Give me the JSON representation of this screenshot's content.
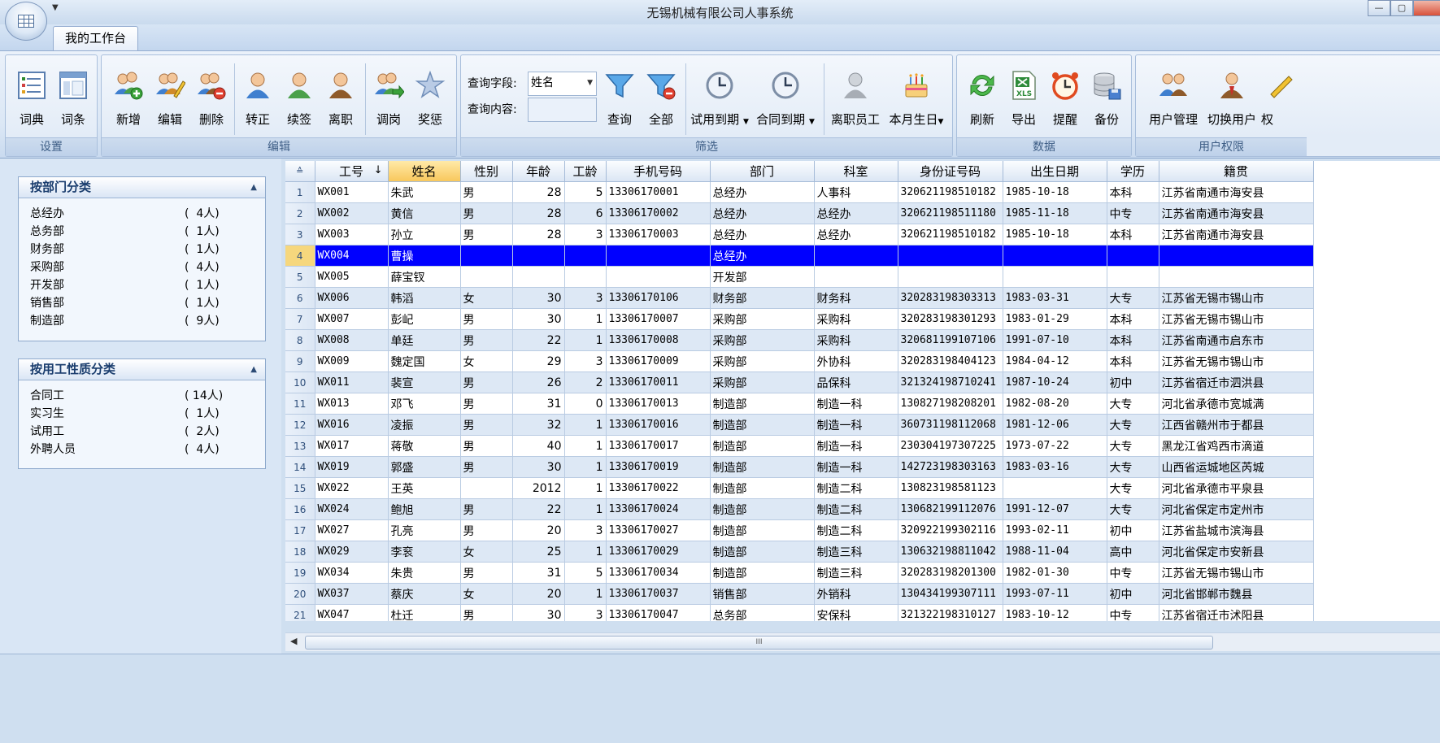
{
  "window": {
    "title": "无锡机械有限公司人事系统"
  },
  "ribbon": {
    "tab": "我的工作台",
    "groups": {
      "settings": {
        "label": "设置",
        "buttons": [
          "词典",
          "词条"
        ]
      },
      "edit": {
        "label": "编辑",
        "buttons": [
          "新增",
          "编辑",
          "删除",
          "转正",
          "续签",
          "离职",
          "调岗",
          "奖惩"
        ]
      },
      "filter": {
        "label": "筛选",
        "query_field_label": "查询字段:",
        "query_field_value": "姓名",
        "query_content_label": "查询内容:",
        "query_content_value": "",
        "buttons": [
          "查询",
          "全部",
          "试用到期",
          "合同到期",
          "离职员工",
          "本月生日"
        ]
      },
      "data": {
        "label": "数据",
        "buttons": [
          "刷新",
          "导出",
          "提醒",
          "备份"
        ]
      },
      "rights": {
        "label": "用户权限",
        "buttons": [
          "用户管理",
          "切换用户",
          "权"
        ]
      }
    },
    "icons": {
      "xls_text": "XLS"
    }
  },
  "left_panel": {
    "by_department": {
      "title": "按部门分类",
      "items": [
        {
          "name": "总经办",
          "count": "(  4人)"
        },
        {
          "name": "总务部",
          "count": "(  1人)"
        },
        {
          "name": "财务部",
          "count": "(  1人)"
        },
        {
          "name": "采购部",
          "count": "(  4人)"
        },
        {
          "name": "开发部",
          "count": "(  1人)"
        },
        {
          "name": "销售部",
          "count": "(  1人)"
        },
        {
          "name": "制造部",
          "count": "(  9人)"
        }
      ]
    },
    "by_employment_type": {
      "title": "按用工性质分类",
      "items": [
        {
          "name": "合同工",
          "count": "( 14人)"
        },
        {
          "name": "实习生",
          "count": "(  1人)"
        },
        {
          "name": "试用工",
          "count": "(  2人)"
        },
        {
          "name": "外聘人员",
          "count": "(  4人)"
        }
      ]
    }
  },
  "grid": {
    "sort_glyph": "↓",
    "corner_glyph": "≙",
    "columns": [
      "工号",
      "姓名",
      "性别",
      "年龄",
      "工龄",
      "手机号码",
      "部门",
      "科室",
      "身份证号码",
      "出生日期",
      "学历",
      "籍贯"
    ],
    "selected_row": 4,
    "rows": [
      [
        "1",
        "WX001",
        "朱武",
        "男",
        "28",
        "5",
        "13306170001",
        "总经办",
        "人事科",
        "320621198510182",
        "1985-10-18",
        "本科",
        "江苏省南通市海安县"
      ],
      [
        "2",
        "WX002",
        "黄信",
        "男",
        "28",
        "6",
        "13306170002",
        "总经办",
        "总经办",
        "320621198511180",
        "1985-11-18",
        "中专",
        "江苏省南通市海安县"
      ],
      [
        "3",
        "WX003",
        "孙立",
        "男",
        "28",
        "3",
        "13306170003",
        "总经办",
        "总经办",
        "320621198510182",
        "1985-10-18",
        "本科",
        "江苏省南通市海安县"
      ],
      [
        "4",
        "WX004",
        "曹操",
        "",
        "",
        "",
        "",
        "总经办",
        "",
        "",
        "",
        "",
        ""
      ],
      [
        "5",
        "WX005",
        "薛宝钗",
        "",
        "",
        "",
        "",
        "开发部",
        "",
        "",
        "",
        "",
        ""
      ],
      [
        "6",
        "WX006",
        "韩滔",
        "女",
        "30",
        "3",
        "13306170106",
        "财务部",
        "财务科",
        "320283198303313",
        "1983-03-31",
        "大专",
        "江苏省无锡市锡山市"
      ],
      [
        "7",
        "WX007",
        "彭屺",
        "男",
        "30",
        "1",
        "13306170007",
        "采购部",
        "采购科",
        "320283198301293",
        "1983-01-29",
        "本科",
        "江苏省无锡市锡山市"
      ],
      [
        "8",
        "WX008",
        "单廷",
        "男",
        "22",
        "1",
        "13306170008",
        "采购部",
        "采购科",
        "320681199107106",
        "1991-07-10",
        "本科",
        "江苏省南通市启东市"
      ],
      [
        "9",
        "WX009",
        "魏定国",
        "女",
        "29",
        "3",
        "13306170009",
        "采购部",
        "外协科",
        "320283198404123",
        "1984-04-12",
        "本科",
        "江苏省无锡市锡山市"
      ],
      [
        "10",
        "WX011",
        "裴宣",
        "男",
        "26",
        "2",
        "13306170011",
        "采购部",
        "品保科",
        "321324198710241",
        "1987-10-24",
        "初中",
        "江苏省宿迁市泗洪县"
      ],
      [
        "11",
        "WX013",
        "邓飞",
        "男",
        "31",
        "0",
        "13306170013",
        "制造部",
        "制造一科",
        "130827198208201",
        "1982-08-20",
        "大专",
        "河北省承德市宽城满"
      ],
      [
        "12",
        "WX016",
        "凌振",
        "男",
        "32",
        "1",
        "13306170016",
        "制造部",
        "制造一科",
        "360731198112068",
        "1981-12-06",
        "大专",
        "江西省赣州市于都县"
      ],
      [
        "13",
        "WX017",
        "蒋敬",
        "男",
        "40",
        "1",
        "13306170017",
        "制造部",
        "制造一科",
        "230304197307225",
        "1973-07-22",
        "大专",
        "黑龙江省鸡西市滴道"
      ],
      [
        "14",
        "WX019",
        "郭盛",
        "男",
        "30",
        "1",
        "13306170019",
        "制造部",
        "制造一科",
        "142723198303163",
        "1983-03-16",
        "大专",
        "山西省运城地区芮城"
      ],
      [
        "15",
        "WX022",
        "王英",
        "",
        "2012",
        "1",
        "13306170022",
        "制造部",
        "制造二科",
        "130823198581123",
        "",
        "大专",
        "河北省承德市平泉县"
      ],
      [
        "16",
        "WX024",
        "鲍旭",
        "男",
        "22",
        "1",
        "13306170024",
        "制造部",
        "制造二科",
        "130682199112076",
        "1991-12-07",
        "大专",
        "河北省保定市定州市"
      ],
      [
        "17",
        "WX027",
        "孔亮",
        "男",
        "20",
        "3",
        "13306170027",
        "制造部",
        "制造二科",
        "320922199302116",
        "1993-02-11",
        "初中",
        "江苏省盐城市滨海县"
      ],
      [
        "18",
        "WX029",
        "李衮",
        "女",
        "25",
        "1",
        "13306170029",
        "制造部",
        "制造三科",
        "130632198811042",
        "1988-11-04",
        "高中",
        "河北省保定市安新县"
      ],
      [
        "19",
        "WX034",
        "朱贵",
        "男",
        "31",
        "5",
        "13306170034",
        "制造部",
        "制造三科",
        "320283198201300",
        "1982-01-30",
        "中专",
        "江苏省无锡市锡山市"
      ],
      [
        "20",
        "WX037",
        "蔡庆",
        "女",
        "20",
        "1",
        "13306170037",
        "销售部",
        "外销科",
        "130434199307111",
        "1993-07-11",
        "初中",
        "河北省邯郸市魏县"
      ],
      [
        "21",
        "WX047",
        "杜迁",
        "男",
        "30",
        "3",
        "13306170047",
        "总务部",
        "安保科",
        "321322198310127",
        "1983-10-12",
        "中专",
        "江苏省宿迁市沭阳县"
      ]
    ]
  },
  "scrollbar": {
    "thumb_grip": "III"
  }
}
